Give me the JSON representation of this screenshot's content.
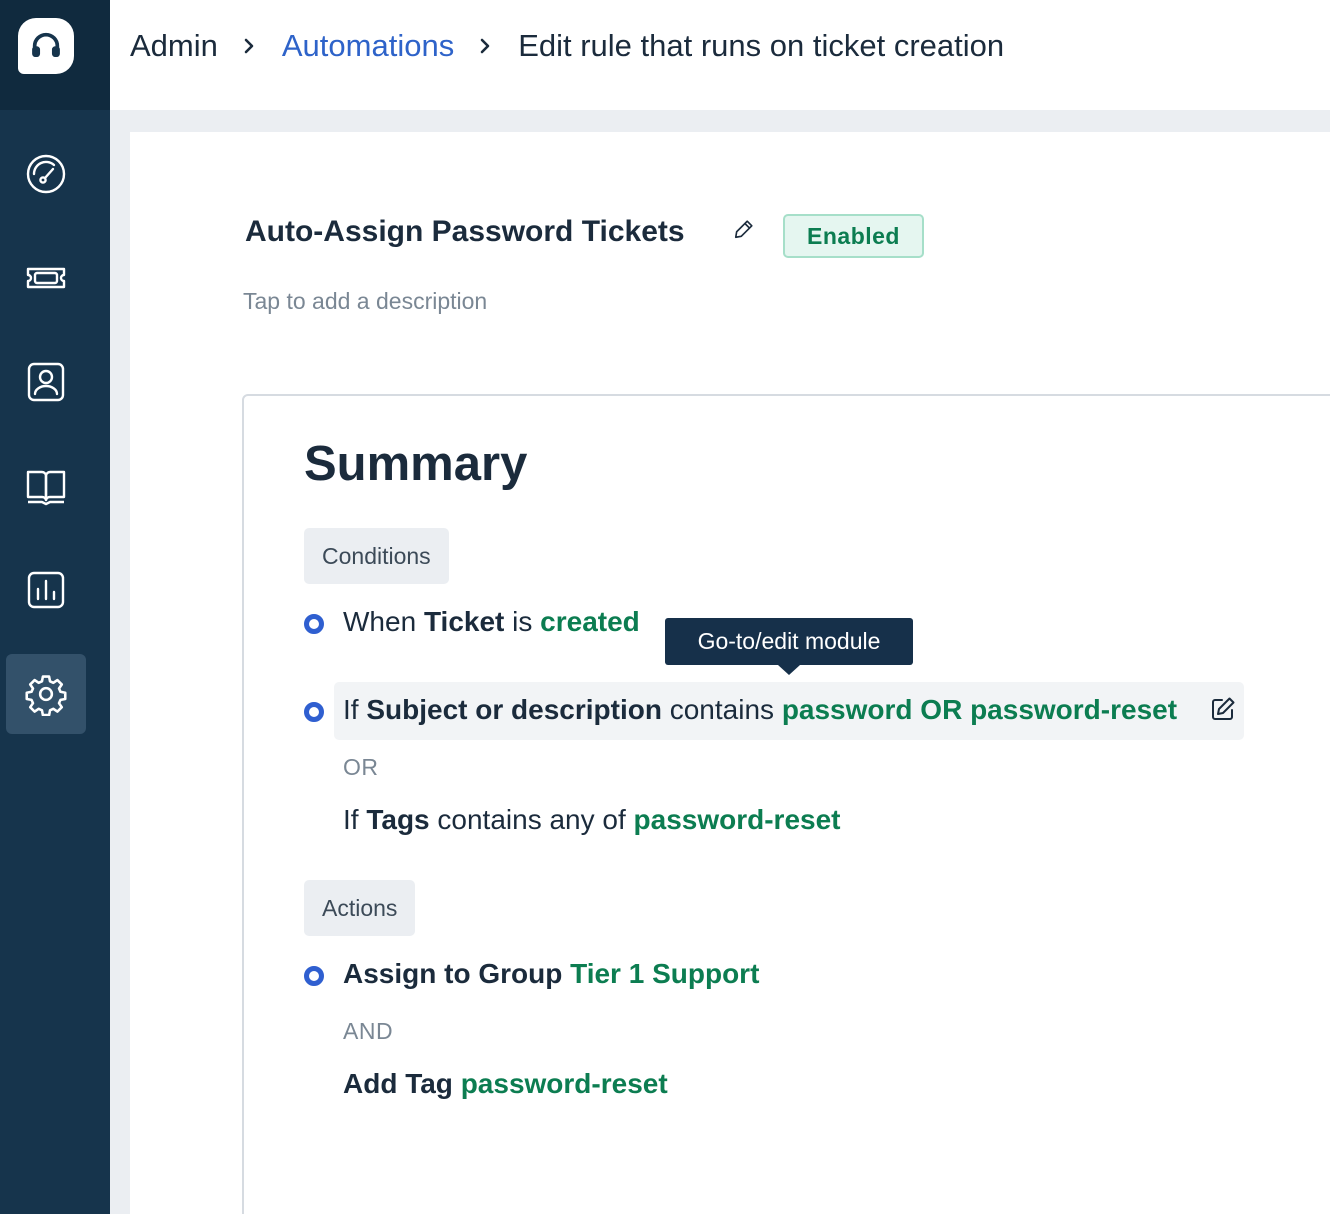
{
  "sidebar": {
    "logo_icon": "headset-icon",
    "items": [
      {
        "icon": "dashboard-gauge-icon"
      },
      {
        "icon": "ticket-icon"
      },
      {
        "icon": "contacts-icon"
      },
      {
        "icon": "knowledge-base-book-icon"
      },
      {
        "icon": "reports-chart-icon"
      },
      {
        "icon": "settings-gear-icon",
        "active": true
      }
    ]
  },
  "breadcrumb": {
    "admin": "Admin",
    "automations": "Automations",
    "current": "Edit rule that runs on ticket creation"
  },
  "rule": {
    "title": "Auto-Assign Password Tickets",
    "status": "Enabled",
    "description_placeholder": "Tap to add a description"
  },
  "summary": {
    "title": "Summary",
    "conditions_label": "Conditions",
    "condition1": {
      "prefix": "When",
      "field": "Ticket",
      "verb": "is",
      "value": "created"
    },
    "condition2": {
      "prefix": "If",
      "field": "Subject or description",
      "verb": "contains",
      "value": "password OR password-reset"
    },
    "or_label": "OR",
    "condition3": {
      "prefix": "If",
      "field": "Tags",
      "verb": "contains any of",
      "value": "password-reset"
    },
    "actions_label": "Actions",
    "action1": {
      "verb": "Assign to Group",
      "value": "Tier 1 Support"
    },
    "and_label": "AND",
    "action2": {
      "verb": "Add Tag",
      "value": "password-reset"
    }
  },
  "tooltip": "Go-to/edit module",
  "colors": {
    "sidebar": "#16344c",
    "link": "#2e63c9",
    "value_green": "#0c7d51",
    "bullet_blue": "#2f5fd0",
    "tooltip_bg": "#16304a"
  }
}
